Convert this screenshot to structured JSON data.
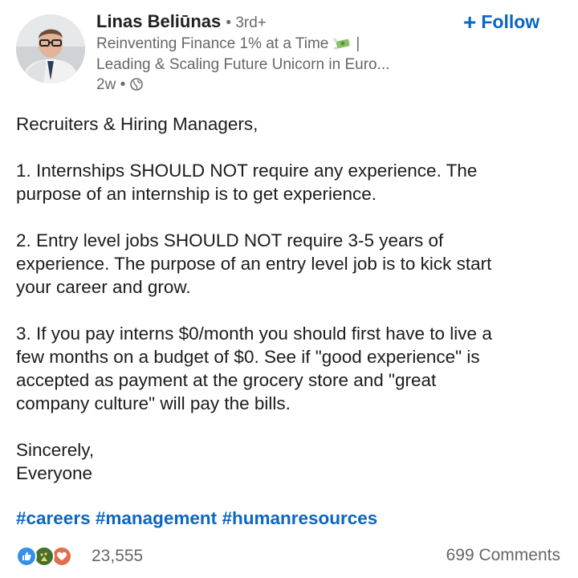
{
  "author": {
    "name": "Linas Beliūnas",
    "degree": "3rd+",
    "headline_line1_pre": "Reinventing Finance 1% at a Time",
    "headline_line1_post": "|",
    "headline_line2": "Leading & Scaling Future Unicorn in Euro...",
    "timestamp": "2w",
    "visibility_icon": "globe-icon",
    "avatar_icon": "profile-photo"
  },
  "follow_button": {
    "plus": "+",
    "label": "Follow",
    "color": "#0a66c2"
  },
  "post": {
    "greeting": "Recruiters & Hiring Managers,",
    "point1": [
      "1. Internships SHOULD NOT require any experience. The",
      "purpose of an internship is to get experience."
    ],
    "point2": [
      "2. Entry level jobs SHOULD NOT require 3-5 years of",
      "experience. The purpose of an entry level job is to kick start",
      "your career and grow."
    ],
    "point3": [
      "3. If you pay interns $0/month you should first have to live a",
      "few months on a budget of $0. See if \"good experience\" is",
      "accepted as payment at the grocery store and \"great",
      "company culture\" will pay the bills."
    ],
    "signoff": [
      "Sincerely,",
      "Everyone"
    ],
    "hashtags": [
      "#careers",
      "#management",
      "#humanresources"
    ]
  },
  "social": {
    "reaction_icons": [
      "like-icon",
      "celebrate-icon",
      "love-icon"
    ],
    "reactions_count": "23,555",
    "comments": "699 Comments"
  }
}
